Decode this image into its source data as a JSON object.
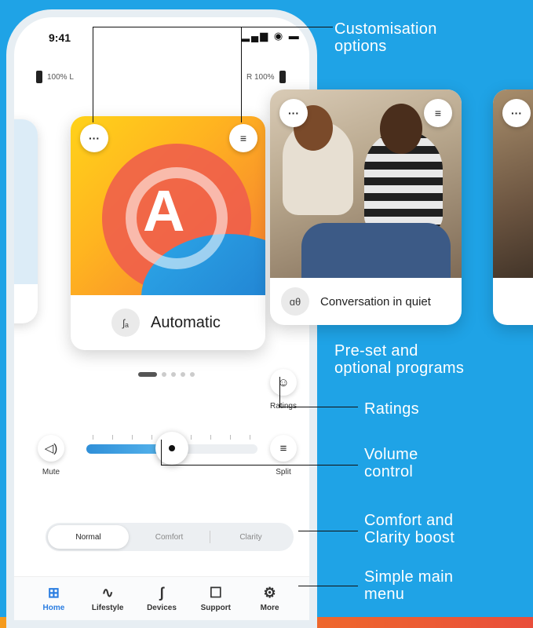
{
  "status": {
    "time": "9:41",
    "icons_text": "▂▄▆ ◉ ▬",
    "left_battery": "100% L",
    "right_battery": "R 100%"
  },
  "main_card": {
    "letter": "A",
    "label": "Automatic",
    "more_glyph": "···",
    "tune_glyph": "≡",
    "program_glyph": "ʃₐ"
  },
  "conversation_card": {
    "label": "Conversation in quiet",
    "more_glyph": "···",
    "tune_glyph": "≡",
    "program_glyph": "ɑθ"
  },
  "peek_card": {
    "more_glyph": "···"
  },
  "ratings": {
    "label": "Ratings",
    "glyph": "☺"
  },
  "volume": {
    "mute_label": "Mute",
    "mute_glyph": "◁)",
    "split_label": "Split",
    "split_glyph": "≡",
    "level": 0.5
  },
  "modes": {
    "items": [
      "Normal",
      "Comfort",
      "Clarity"
    ],
    "selected": "Normal"
  },
  "nav": {
    "items": [
      {
        "label": "Home",
        "glyph": "⊞",
        "icon": "home-grid-icon",
        "active": true
      },
      {
        "label": "Lifestyle",
        "glyph": "∿",
        "icon": "pulse-icon",
        "active": false
      },
      {
        "label": "Devices",
        "glyph": "ʃ",
        "icon": "hearing-aid-icon",
        "active": false
      },
      {
        "label": "Support",
        "glyph": "☐",
        "icon": "chat-icon",
        "active": false
      },
      {
        "label": "More",
        "glyph": "⚙",
        "icon": "gear-icon",
        "active": false
      }
    ]
  },
  "annotations": {
    "customisation": [
      "Customisation",
      "options"
    ],
    "programs": [
      "Pre-set and",
      "optional programs"
    ],
    "ratings": "Ratings",
    "volume": [
      "Volume",
      "control"
    ],
    "boost": [
      "Comfort and",
      "Clarity boost"
    ],
    "menu": [
      "Simple main",
      "menu"
    ]
  },
  "colors": {
    "background": "#1fa3e6",
    "accent": "#2a7de1"
  }
}
